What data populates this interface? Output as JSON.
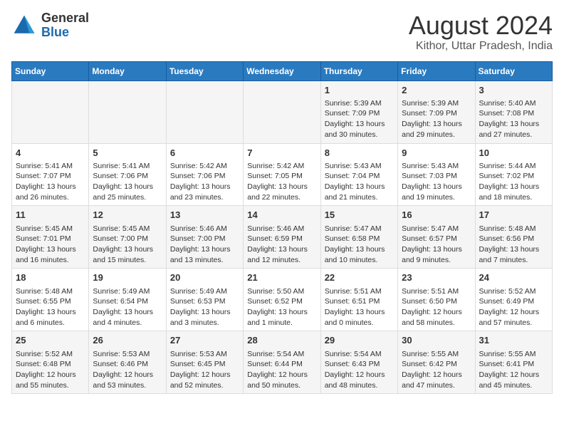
{
  "logo": {
    "general": "General",
    "blue": "Blue"
  },
  "title": "August 2024",
  "subtitle": "Kithor, Uttar Pradesh, India",
  "days_of_week": [
    "Sunday",
    "Monday",
    "Tuesday",
    "Wednesday",
    "Thursday",
    "Friday",
    "Saturday"
  ],
  "weeks": [
    [
      {
        "day": "",
        "info": ""
      },
      {
        "day": "",
        "info": ""
      },
      {
        "day": "",
        "info": ""
      },
      {
        "day": "",
        "info": ""
      },
      {
        "day": "1",
        "info": "Sunrise: 5:39 AM\nSunset: 7:09 PM\nDaylight: 13 hours\nand 30 minutes."
      },
      {
        "day": "2",
        "info": "Sunrise: 5:39 AM\nSunset: 7:09 PM\nDaylight: 13 hours\nand 29 minutes."
      },
      {
        "day": "3",
        "info": "Sunrise: 5:40 AM\nSunset: 7:08 PM\nDaylight: 13 hours\nand 27 minutes."
      }
    ],
    [
      {
        "day": "4",
        "info": "Sunrise: 5:41 AM\nSunset: 7:07 PM\nDaylight: 13 hours\nand 26 minutes."
      },
      {
        "day": "5",
        "info": "Sunrise: 5:41 AM\nSunset: 7:06 PM\nDaylight: 13 hours\nand 25 minutes."
      },
      {
        "day": "6",
        "info": "Sunrise: 5:42 AM\nSunset: 7:06 PM\nDaylight: 13 hours\nand 23 minutes."
      },
      {
        "day": "7",
        "info": "Sunrise: 5:42 AM\nSunset: 7:05 PM\nDaylight: 13 hours\nand 22 minutes."
      },
      {
        "day": "8",
        "info": "Sunrise: 5:43 AM\nSunset: 7:04 PM\nDaylight: 13 hours\nand 21 minutes."
      },
      {
        "day": "9",
        "info": "Sunrise: 5:43 AM\nSunset: 7:03 PM\nDaylight: 13 hours\nand 19 minutes."
      },
      {
        "day": "10",
        "info": "Sunrise: 5:44 AM\nSunset: 7:02 PM\nDaylight: 13 hours\nand 18 minutes."
      }
    ],
    [
      {
        "day": "11",
        "info": "Sunrise: 5:45 AM\nSunset: 7:01 PM\nDaylight: 13 hours\nand 16 minutes."
      },
      {
        "day": "12",
        "info": "Sunrise: 5:45 AM\nSunset: 7:00 PM\nDaylight: 13 hours\nand 15 minutes."
      },
      {
        "day": "13",
        "info": "Sunrise: 5:46 AM\nSunset: 7:00 PM\nDaylight: 13 hours\nand 13 minutes."
      },
      {
        "day": "14",
        "info": "Sunrise: 5:46 AM\nSunset: 6:59 PM\nDaylight: 13 hours\nand 12 minutes."
      },
      {
        "day": "15",
        "info": "Sunrise: 5:47 AM\nSunset: 6:58 PM\nDaylight: 13 hours\nand 10 minutes."
      },
      {
        "day": "16",
        "info": "Sunrise: 5:47 AM\nSunset: 6:57 PM\nDaylight: 13 hours\nand 9 minutes."
      },
      {
        "day": "17",
        "info": "Sunrise: 5:48 AM\nSunset: 6:56 PM\nDaylight: 13 hours\nand 7 minutes."
      }
    ],
    [
      {
        "day": "18",
        "info": "Sunrise: 5:48 AM\nSunset: 6:55 PM\nDaylight: 13 hours\nand 6 minutes."
      },
      {
        "day": "19",
        "info": "Sunrise: 5:49 AM\nSunset: 6:54 PM\nDaylight: 13 hours\nand 4 minutes."
      },
      {
        "day": "20",
        "info": "Sunrise: 5:49 AM\nSunset: 6:53 PM\nDaylight: 13 hours\nand 3 minutes."
      },
      {
        "day": "21",
        "info": "Sunrise: 5:50 AM\nSunset: 6:52 PM\nDaylight: 13 hours\nand 1 minute."
      },
      {
        "day": "22",
        "info": "Sunrise: 5:51 AM\nSunset: 6:51 PM\nDaylight: 13 hours\nand 0 minutes."
      },
      {
        "day": "23",
        "info": "Sunrise: 5:51 AM\nSunset: 6:50 PM\nDaylight: 12 hours\nand 58 minutes."
      },
      {
        "day": "24",
        "info": "Sunrise: 5:52 AM\nSunset: 6:49 PM\nDaylight: 12 hours\nand 57 minutes."
      }
    ],
    [
      {
        "day": "25",
        "info": "Sunrise: 5:52 AM\nSunset: 6:48 PM\nDaylight: 12 hours\nand 55 minutes."
      },
      {
        "day": "26",
        "info": "Sunrise: 5:53 AM\nSunset: 6:46 PM\nDaylight: 12 hours\nand 53 minutes."
      },
      {
        "day": "27",
        "info": "Sunrise: 5:53 AM\nSunset: 6:45 PM\nDaylight: 12 hours\nand 52 minutes."
      },
      {
        "day": "28",
        "info": "Sunrise: 5:54 AM\nSunset: 6:44 PM\nDaylight: 12 hours\nand 50 minutes."
      },
      {
        "day": "29",
        "info": "Sunrise: 5:54 AM\nSunset: 6:43 PM\nDaylight: 12 hours\nand 48 minutes."
      },
      {
        "day": "30",
        "info": "Sunrise: 5:55 AM\nSunset: 6:42 PM\nDaylight: 12 hours\nand 47 minutes."
      },
      {
        "day": "31",
        "info": "Sunrise: 5:55 AM\nSunset: 6:41 PM\nDaylight: 12 hours\nand 45 minutes."
      }
    ]
  ]
}
